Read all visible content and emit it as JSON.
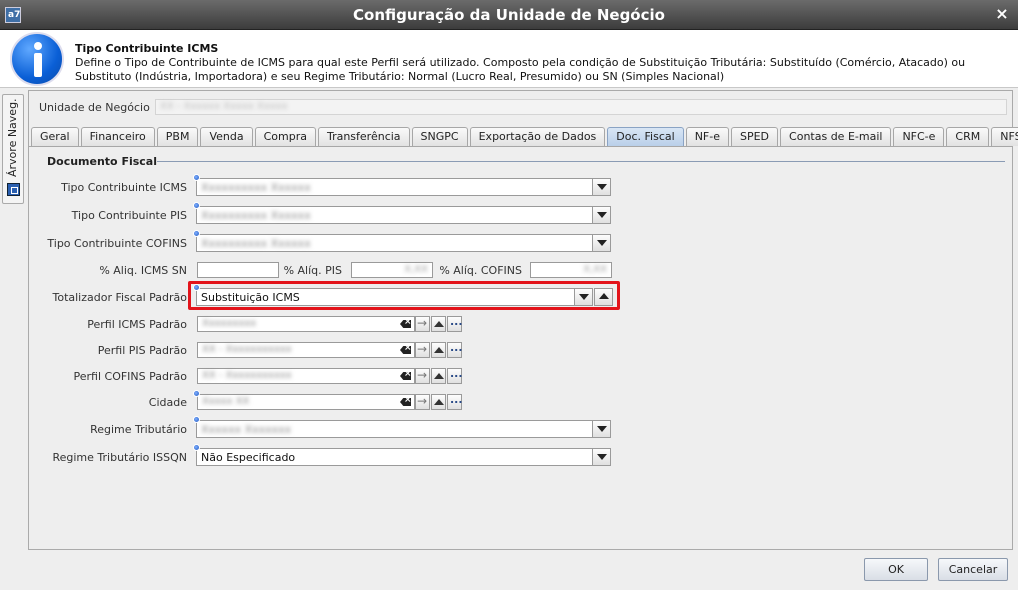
{
  "window": {
    "title": "Configuração da Unidade de Negócio",
    "close_glyph": "×"
  },
  "info": {
    "icon": "info-icon",
    "title": "Tipo Contribuinte ICMS",
    "description": "Define o Tipo de Contribuinte de ICMS para qual este Perfil será utilizado. Composto pela condição de Substituição Tributária: Substituído (Comércio, Atacado) ou Substituto (Indústria, Importadora) e seu Regime Tributário: Normal (Lucro Real, Presumido) ou SN (Simples Nacional)"
  },
  "side_tab": {
    "label": "Árvore Naveg."
  },
  "unit": {
    "label": "Unidade de Negócio",
    "value": "XX - Xxxxxx Xxxxx Xxxxx"
  },
  "tabs": [
    {
      "label": "Geral"
    },
    {
      "label": "Financeiro"
    },
    {
      "label": "PBM"
    },
    {
      "label": "Venda"
    },
    {
      "label": "Compra"
    },
    {
      "label": "Transferência"
    },
    {
      "label": "SNGPC"
    },
    {
      "label": "Exportação de Dados"
    },
    {
      "label": "Doc. Fiscal",
      "active": true
    },
    {
      "label": "NF-e"
    },
    {
      "label": "SPED"
    },
    {
      "label": "Contas de E-mail"
    },
    {
      "label": "NFC-e"
    },
    {
      "label": "CRM"
    },
    {
      "label": "NFS-e"
    }
  ],
  "section": {
    "title": "Documento Fiscal"
  },
  "fields": {
    "tipo_icms": {
      "label": "Tipo Contribuinte ICMS",
      "value": "Xxxxxxxxxx Xxxxxx"
    },
    "tipo_pis": {
      "label": "Tipo Contribuinte PIS",
      "value": "Xxxxxxxxxx Xxxxxx"
    },
    "tipo_cofins": {
      "label": "Tipo Contribuinte COFINS",
      "value": "Xxxxxxxxxx Xxxxxx"
    },
    "aliq_icms_sn": {
      "label": "% Aliq. ICMS SN",
      "value": ""
    },
    "aliq_pis": {
      "label": "% Alíq. PIS",
      "value": "X,XX"
    },
    "aliq_cofins": {
      "label": "% Alíq. COFINS",
      "value": "X,XX"
    },
    "totalizador": {
      "label": "Totalizador Fiscal Padrão",
      "value": "Substituição ICMS"
    },
    "perfil_icms": {
      "label": "Perfil ICMS Padrão",
      "value": "Xxxxxxxxx"
    },
    "perfil_pis": {
      "label": "Perfil PIS Padrão",
      "value": "XX - Xxxxxxxxxxx"
    },
    "perfil_cofins": {
      "label": "Perfil COFINS Padrão",
      "value": "XX - Xxxxxxxxxxx"
    },
    "cidade": {
      "label": "Cidade",
      "value": "Xxxxx XX"
    },
    "regime": {
      "label": "Regime Tributário",
      "value": "Xxxxxx Xxxxxxx"
    },
    "regime_issqn": {
      "label": "Regime Tributário ISSQN",
      "value": "Não Especificado"
    }
  },
  "buttons": {
    "ok": "OK",
    "cancel": "Cancelar"
  },
  "colors": {
    "highlight": "#e3141b",
    "active_tab": "#b9cfe9"
  }
}
